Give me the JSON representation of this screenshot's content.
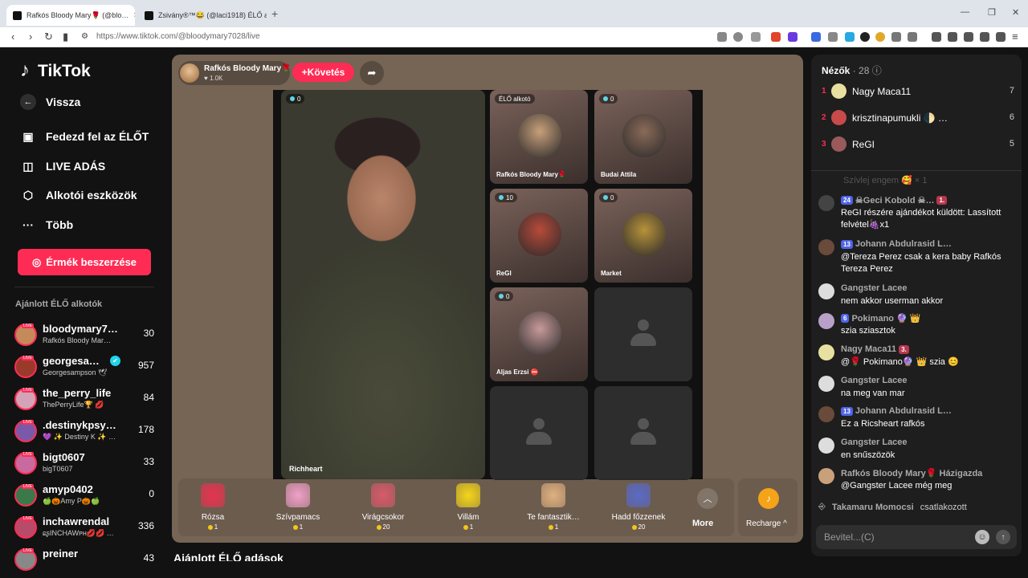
{
  "browser": {
    "tabs": [
      {
        "title": "Rafkós Bloody Mary🌹 (@blo…",
        "active": true
      },
      {
        "title": "Zsivány®™😂 (@laci1918) ÉLŐ adá…",
        "active": false
      }
    ],
    "url": "https://www.tiktok.com/@bloodymary7028/live"
  },
  "nav": {
    "logo": "TikTok",
    "back": "Vissza",
    "items": [
      {
        "label": "Fedezd fel az ÉLŐT",
        "icon": "live-tv-icon"
      },
      {
        "label": "LIVE ADÁS",
        "icon": "video-camera-icon"
      },
      {
        "label": "Alkotói eszközök",
        "icon": "creator-tools-icon"
      },
      {
        "label": "Több",
        "icon": "more-dots-icon"
      }
    ],
    "coin_button": "Érmék beszerzése",
    "suggested_title": "Ajánlott ÉLŐ alkotók",
    "live_badge": "LIVE",
    "creators": [
      {
        "name": "bloodymary7…",
        "sub": "Rafkós Bloody Mar…",
        "count": "30",
        "color": "#c48a5a"
      },
      {
        "name": "georgesa…",
        "sub": "Georgesampson 🕊",
        "count": "957",
        "color": "#9a3a2a",
        "verified": true
      },
      {
        "name": "the_perry_life",
        "sub": "ThePerryLife🏆 💋",
        "count": "84",
        "color": "#d4a3b8"
      },
      {
        "name": ".destinykpsy…",
        "sub": "💜 ✨ Destiny K ✨ …",
        "count": "178",
        "color": "#7a5aa8"
      },
      {
        "name": "bigt0607",
        "sub": "bigT0607",
        "count": "33",
        "color": "#c86aa0"
      },
      {
        "name": "amyp0402",
        "sub": "🍏🎃Amy P🎃🍏",
        "count": "0",
        "color": "#3a7a4a"
      },
      {
        "name": "inchawrendal",
        "sub": "ɕʂINCHAWᴘʜ💋💋 …",
        "count": "336",
        "color": "#b84a6a"
      },
      {
        "name": "preiner",
        "sub": "",
        "count": "43",
        "color": "#888888"
      }
    ]
  },
  "live": {
    "host_name": "Rafkós Bloody Mary🌹",
    "host_likes": "1.0K",
    "follow": "+Követés",
    "main_guest": {
      "name": "Richheart",
      "score": "0"
    },
    "tiles": [
      {
        "name": "Rafkós Bloody Mary🌹",
        "badge": "ÉLŐ alkotó",
        "avatar": "#c8a07a"
      },
      {
        "name": "Budai Attila",
        "badge": "0",
        "avatar": "#8a6a58"
      },
      {
        "name": "ReGI",
        "badge": "10",
        "avatar": "#b84a3a"
      },
      {
        "name": "Market",
        "badge": "0",
        "avatar": "#b8923a"
      },
      {
        "name": "Aljas Erzsi ⛔",
        "badge": "0",
        "avatar": "#c89a9a"
      }
    ],
    "gifts": [
      {
        "name": "Rózsa",
        "price": "1",
        "color": "#e8334f"
      },
      {
        "name": "Szívpamacs",
        "price": "1",
        "color": "#f0a0c8"
      },
      {
        "name": "Virágcsokor",
        "price": "20",
        "color": "#d85a6a"
      },
      {
        "name": "Villám",
        "price": "1",
        "color": "#f5d61a"
      },
      {
        "name": "Te fantasztik…",
        "price": "1",
        "color": "#e0b080"
      },
      {
        "name": "Hadd főzzenek",
        "price": "20",
        "color": "#5a6ac8"
      }
    ],
    "more": "More",
    "recharge": "Recharge ^",
    "below_title": "Ajánlott ÉLŐ adások"
  },
  "chat": {
    "viewers_label": "Nézők",
    "viewers_count": "· 28",
    "top_viewers": [
      {
        "rank": "1",
        "name": "Nagy Maca11",
        "score": "7",
        "color": "#e8e0a0"
      },
      {
        "rank": "2",
        "name": "krisztinapumukli 🌓 …",
        "score": "6",
        "color": "#c84a4a"
      },
      {
        "rank": "3",
        "name": "ReGI",
        "score": "5",
        "color": "#9a5a5a"
      }
    ],
    "ghost_text": "Szívlej engem 🥰 × 1",
    "messages": [
      {
        "head": "☠Geci Kobold ☠…",
        "lvl": "24",
        "extra": "1.",
        "text": "ReGI részére ajándékot küldött: Lassított felvétel🍇x1",
        "color": "#444444"
      },
      {
        "head": "Johann Abdulrasid L…",
        "lvl": "13",
        "extra": "",
        "text": "@Tereza Perez csak a kera baby Rafkós Tereza Perez",
        "color": "#6a4a3a"
      },
      {
        "head": "Gangster Lacee",
        "lvl": "",
        "extra": "",
        "text": "nem akkor userman akkor",
        "color": "#dddddd"
      },
      {
        "head": "Pokimano 🔮 👑",
        "lvl": "6",
        "extra": "",
        "text": "szia sziasztok",
        "color": "#b8a0c8"
      },
      {
        "head": "Nagy Maca11",
        "lvl": "",
        "extra": "3.",
        "text": "@🌹 Pokimano🔮 👑 szia 😊",
        "color": "#e8e0a0"
      },
      {
        "head": "Gangster Lacee",
        "lvl": "",
        "extra": "",
        "text": "na meg van mar",
        "color": "#dddddd"
      },
      {
        "head": "Johann Abdulrasid L…",
        "lvl": "13",
        "extra": "",
        "text": "Ez a Ricsheart rafkós",
        "color": "#6a4a3a"
      },
      {
        "head": "Gangster Lacee",
        "lvl": "",
        "extra": "",
        "text": "en snűszözök",
        "color": "#dddddd"
      },
      {
        "head": "Rafkós Bloody Mary🌹 Házigazda",
        "lvl": "",
        "extra": "",
        "text": "@Gangster Lacee még meg",
        "color": "#c8a07a"
      }
    ],
    "joined_name": "Takamaru Momocsi",
    "joined_text": "csatlakozott",
    "input_placeholder": "Bevitel...(C)"
  }
}
